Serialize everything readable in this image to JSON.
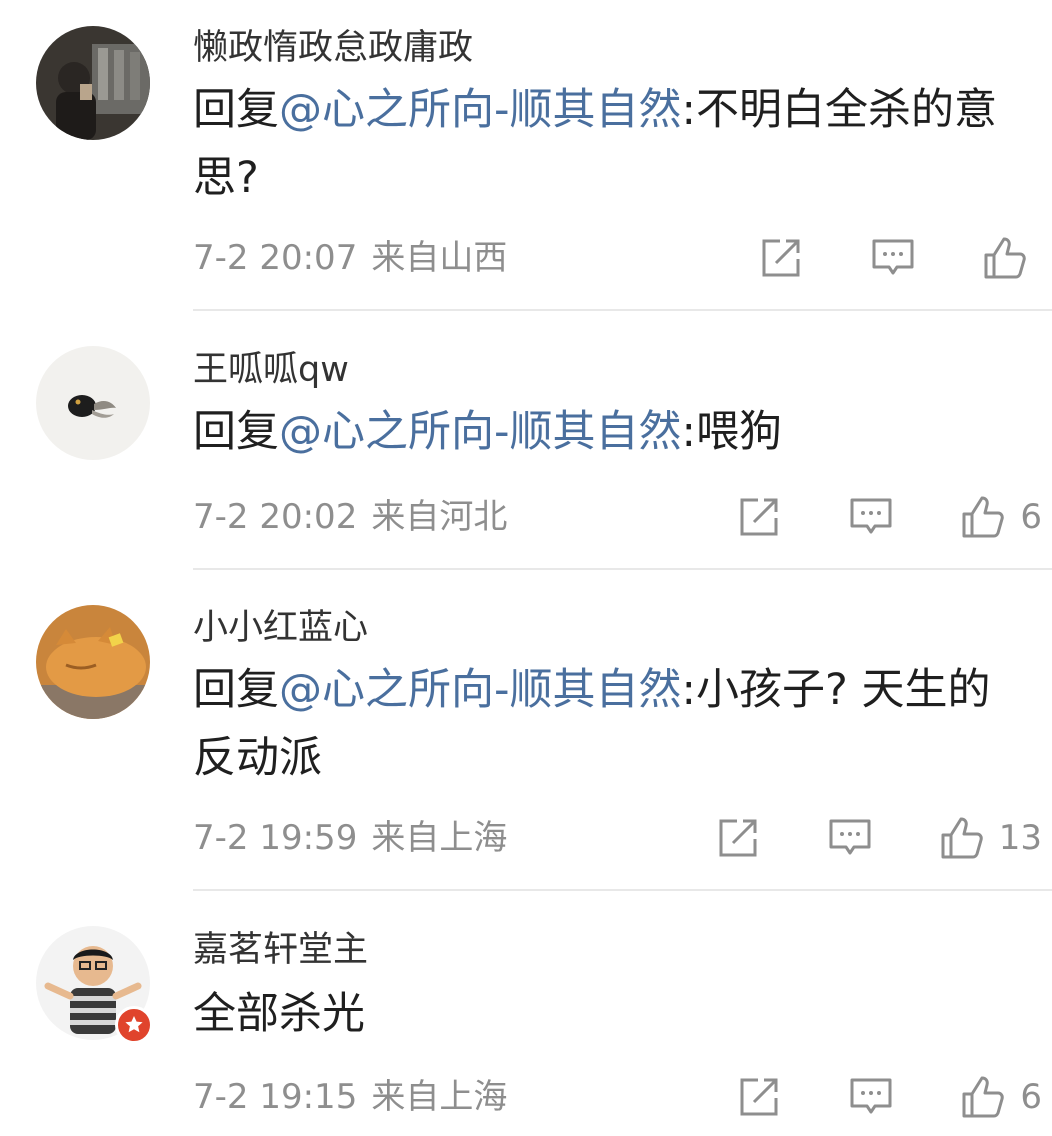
{
  "comments": [
    {
      "username": "懒政惰政怠政庸政",
      "reply_prefix": "回复",
      "mention": "@心之所向-顺其自然",
      "text": ":不明白全杀的意思?",
      "time": "7-2 20:07",
      "location": "来自山西",
      "likes": ""
    },
    {
      "username": "王呱呱qw",
      "reply_prefix": "回复",
      "mention": "@心之所向-顺其自然",
      "text": ":喂狗",
      "time": "7-2 20:02",
      "location": "来自河北",
      "likes": "6"
    },
    {
      "username": "小小红蓝心",
      "reply_prefix": "回复",
      "mention": "@心之所向-顺其自然",
      "text": ":小孩子? 天生的反动派",
      "time": "7-2 19:59",
      "location": "来自上海",
      "likes": "13"
    },
    {
      "username": "嘉茗轩堂主",
      "reply_prefix": "",
      "mention": "",
      "text": "全部杀光",
      "time": "7-2 19:15",
      "location": "来自上海",
      "likes": "6"
    }
  ],
  "icons": {
    "share": "share-icon",
    "comment": "comment-icon",
    "like": "like-icon"
  },
  "colors": {
    "mention": "#4a6f9e",
    "meta": "#8e8e8e",
    "divider": "#e8e8e8"
  }
}
